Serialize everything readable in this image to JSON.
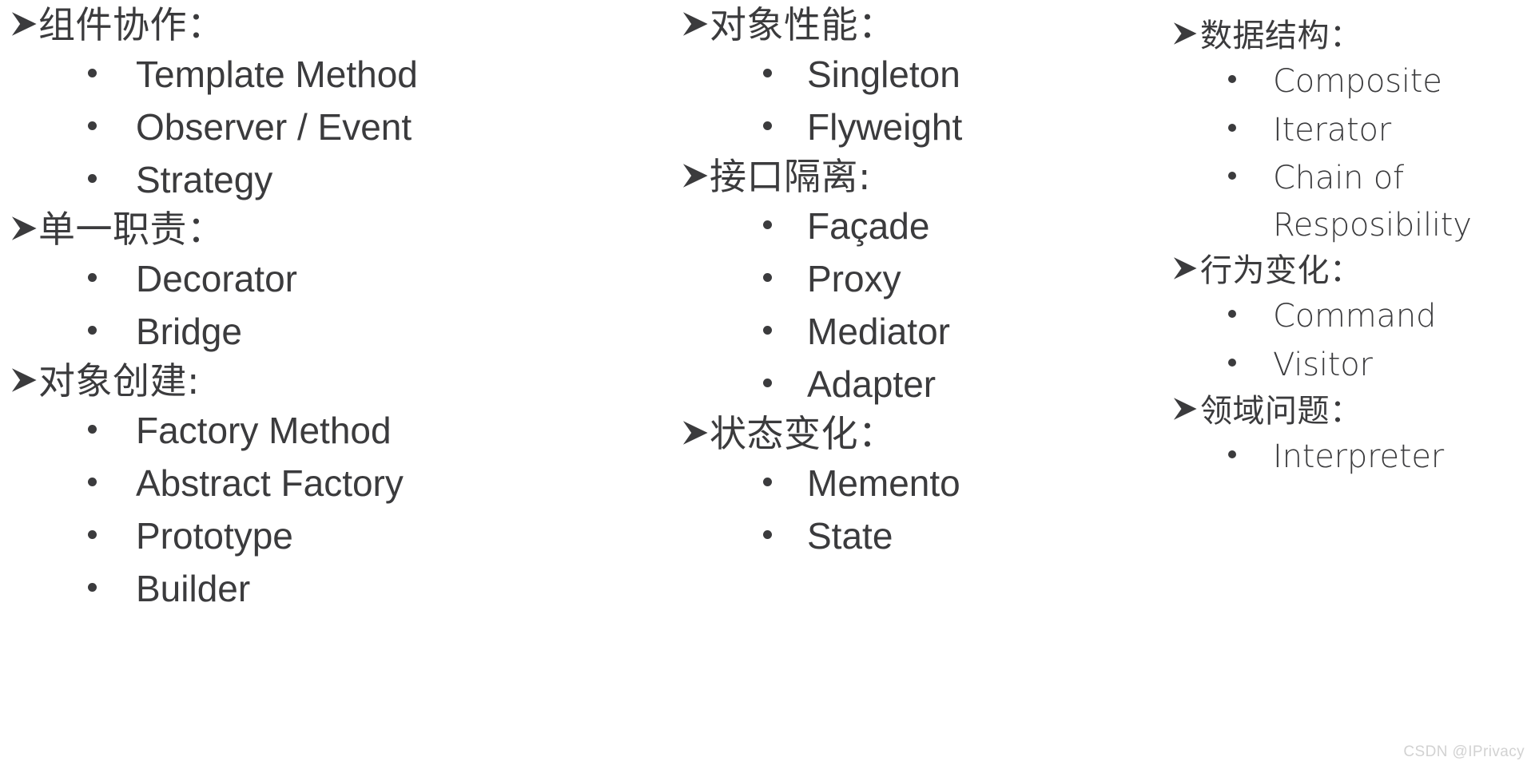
{
  "slide": {
    "background_color": "#ffffff",
    "text_color": "#3b3b3d",
    "bullet_glyphs": {
      "group": "➤",
      "item": "•"
    }
  },
  "columns": [
    {
      "id": "col-0",
      "groups": [
        {
          "title": "组件协作：",
          "items": [
            "Template Method",
            "Observer / Event",
            "Strategy"
          ]
        },
        {
          "title": "单一职责：",
          "items": [
            "Decorator",
            "Bridge"
          ]
        },
        {
          "title": "对象创建:",
          "items": [
            "Factory Method",
            "Abstract Factory",
            "Prototype",
            "Builder"
          ]
        }
      ]
    },
    {
      "id": "col-1",
      "groups": [
        {
          "title": "对象性能：",
          "items": [
            "Singleton",
            "Flyweight"
          ]
        },
        {
          "title": "接口隔离:",
          "items": [
            "Façade",
            "Proxy",
            "Mediator",
            "Adapter"
          ]
        },
        {
          "title": "状态变化：",
          "items": [
            "Memento",
            "State"
          ]
        }
      ]
    },
    {
      "id": "col-2",
      "groups": [
        {
          "title": "数据结构：",
          "items": [
            "Composite",
            "Iterator",
            "Chain of\nResposibility"
          ]
        },
        {
          "title": "行为变化：",
          "items": [
            "Command",
            "Visitor"
          ]
        },
        {
          "title": "领域问题：",
          "items": [
            "Interpreter"
          ]
        }
      ]
    }
  ],
  "watermark": {
    "text": "CSDN @IPrivacy",
    "color": "#d2d2d2"
  }
}
